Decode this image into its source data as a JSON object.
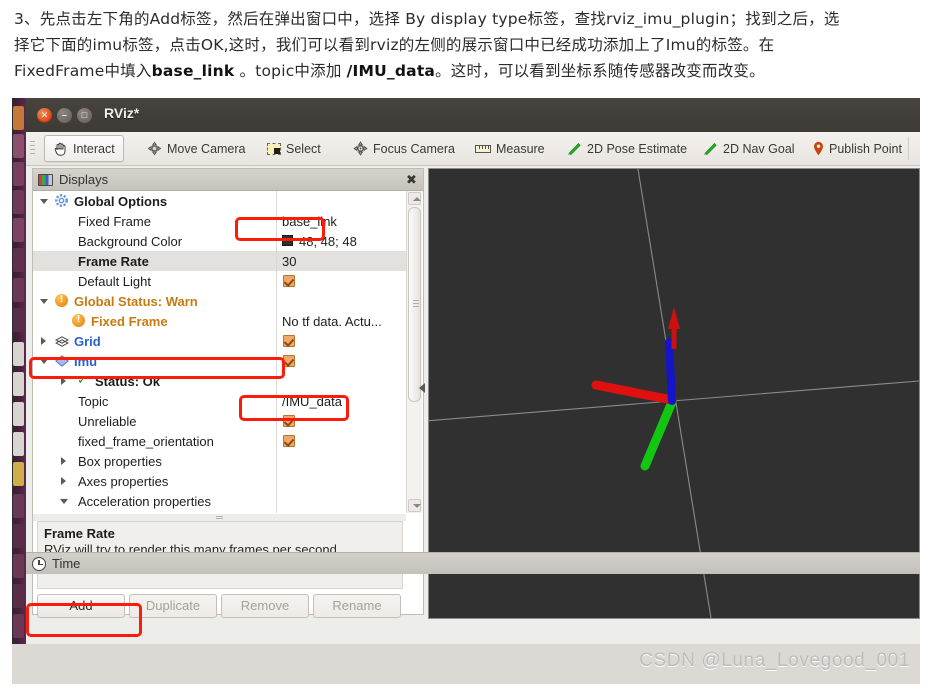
{
  "article": {
    "line1_a": "3、先点击左下角的Add标签，然后在弹出窗口中，选择 By display type标签，查找rviz_imu_plugin；找到之后，选",
    "line2_a": "择它下面的imu标签，点击OK,这时，我们可以看到rviz的左侧的展示窗口中已经成功添加上了Imu的标签。在",
    "line3_a": "FixedFrame中填入",
    "line3_b": "base_link",
    "line3_c": " 。topic中添加 ",
    "line3_d": "/IMU_data",
    "line3_e": "。这时，可以看到坐标系随传感器改变而改变。"
  },
  "window": {
    "title": "RViz*",
    "close_glyph": "✕",
    "minimize_glyph": "–",
    "maximize_glyph": "□"
  },
  "toolbar": {
    "items": [
      {
        "label": "Interact",
        "icon": "hand-icon",
        "active": true
      },
      {
        "label": "Move Camera",
        "icon": "move-camera-icon",
        "active": false
      },
      {
        "label": "Select",
        "icon": "select-icon",
        "active": false
      },
      {
        "label": "Focus Camera",
        "icon": "focus-camera-icon",
        "active": false
      },
      {
        "label": "Measure",
        "icon": "ruler-icon",
        "active": false
      },
      {
        "label": "2D Pose Estimate",
        "icon": "pencil-icon",
        "active": false
      },
      {
        "label": "2D Nav Goal",
        "icon": "pencil-icon",
        "active": false
      },
      {
        "label": "Publish Point",
        "icon": "map-pin-icon",
        "active": false
      }
    ]
  },
  "displays": {
    "title": "Displays",
    "close_glyph": "✖",
    "tree": [
      {
        "label": "Global Options",
        "value": "",
        "indent": 22,
        "expander": "down",
        "icon": "gear-icon",
        "style": "dark",
        "control": "none"
      },
      {
        "label": "Fixed Frame",
        "value": "base_link",
        "indent": 38,
        "expander": "none",
        "icon": "none",
        "style": "plain",
        "control": "text"
      },
      {
        "label": "Background Color",
        "value": "48; 48; 48",
        "indent": 38,
        "expander": "none",
        "icon": "none",
        "style": "plain",
        "control": "swatch"
      },
      {
        "label": "Frame Rate",
        "value": "30",
        "indent": 38,
        "expander": "none",
        "icon": "none",
        "style": "dark",
        "control": "text",
        "selected": true
      },
      {
        "label": "Default Light",
        "value": "",
        "indent": 38,
        "expander": "none",
        "icon": "none",
        "style": "plain",
        "control": "check"
      },
      {
        "label": "Global Status: Warn",
        "value": "",
        "indent": 22,
        "expander": "down",
        "icon": "warning-icon",
        "style": "orange",
        "control": "none"
      },
      {
        "label": "Fixed Frame",
        "value": "No tf data.  Actu...",
        "indent": 38,
        "expander": "none",
        "icon": "warning-icon",
        "style": "orange",
        "control": "text"
      },
      {
        "label": "Grid",
        "value": "",
        "indent": 22,
        "expander": "right",
        "icon": "grid-icon",
        "style": "blue",
        "control": "check"
      },
      {
        "label": "Imu",
        "value": "",
        "indent": 22,
        "expander": "down",
        "icon": "imu-icon",
        "style": "blue",
        "control": "check"
      },
      {
        "label": "Status: Ok",
        "value": "",
        "indent": 54,
        "expander": "right",
        "icon": "check-icon",
        "style": "dark",
        "control": "none"
      },
      {
        "label": "Topic",
        "value": "/IMU_data",
        "indent": 38,
        "expander": "none",
        "icon": "none",
        "style": "plain",
        "control": "text"
      },
      {
        "label": "Unreliable",
        "value": "",
        "indent": 38,
        "expander": "none",
        "icon": "none",
        "style": "plain",
        "control": "check"
      },
      {
        "label": "fixed_frame_orientation",
        "value": "",
        "indent": 38,
        "expander": "none",
        "icon": "none",
        "style": "plain",
        "control": "check"
      },
      {
        "label": "Box properties",
        "value": "",
        "indent": 38,
        "expander": "right",
        "icon": "none",
        "style": "plain",
        "control": "none"
      },
      {
        "label": "Axes properties",
        "value": "",
        "indent": 38,
        "expander": "right",
        "icon": "none",
        "style": "plain",
        "control": "none"
      },
      {
        "label": "Acceleration properties",
        "value": "",
        "indent": 38,
        "expander": "down",
        "icon": "none",
        "style": "plain",
        "control": "none"
      }
    ],
    "help": {
      "title": "Frame Rate",
      "description": "RViz will try to render this many frames per second."
    },
    "buttons": [
      {
        "label": "Add",
        "enabled": true
      },
      {
        "label": "Duplicate",
        "enabled": false
      },
      {
        "label": "Remove",
        "enabled": false
      },
      {
        "label": "Rename",
        "enabled": false
      }
    ]
  },
  "time_panel": {
    "label": "Time",
    "icon": "clock-icon"
  },
  "view3d": {
    "background_color": "#303030",
    "grid_line_color": "#9a9a9a",
    "axes": [
      {
        "name": "x-axis-red",
        "color": "#e01010"
      },
      {
        "name": "y-axis-green",
        "color": "#12c712"
      },
      {
        "name": "z-axis-blue",
        "color": "#1414c8"
      },
      {
        "name": "acceleration-arrow-red",
        "color": "#cc0f0f"
      }
    ]
  },
  "annotations": {
    "highlight_color": "#fc1c07",
    "boxes": [
      {
        "name": "fixed-frame-value-highlight"
      },
      {
        "name": "imu-row-highlight"
      },
      {
        "name": "topic-value-highlight"
      },
      {
        "name": "add-button-highlight"
      }
    ]
  },
  "watermark": {
    "text": "CSDN @Luna_Lovegood_001"
  }
}
